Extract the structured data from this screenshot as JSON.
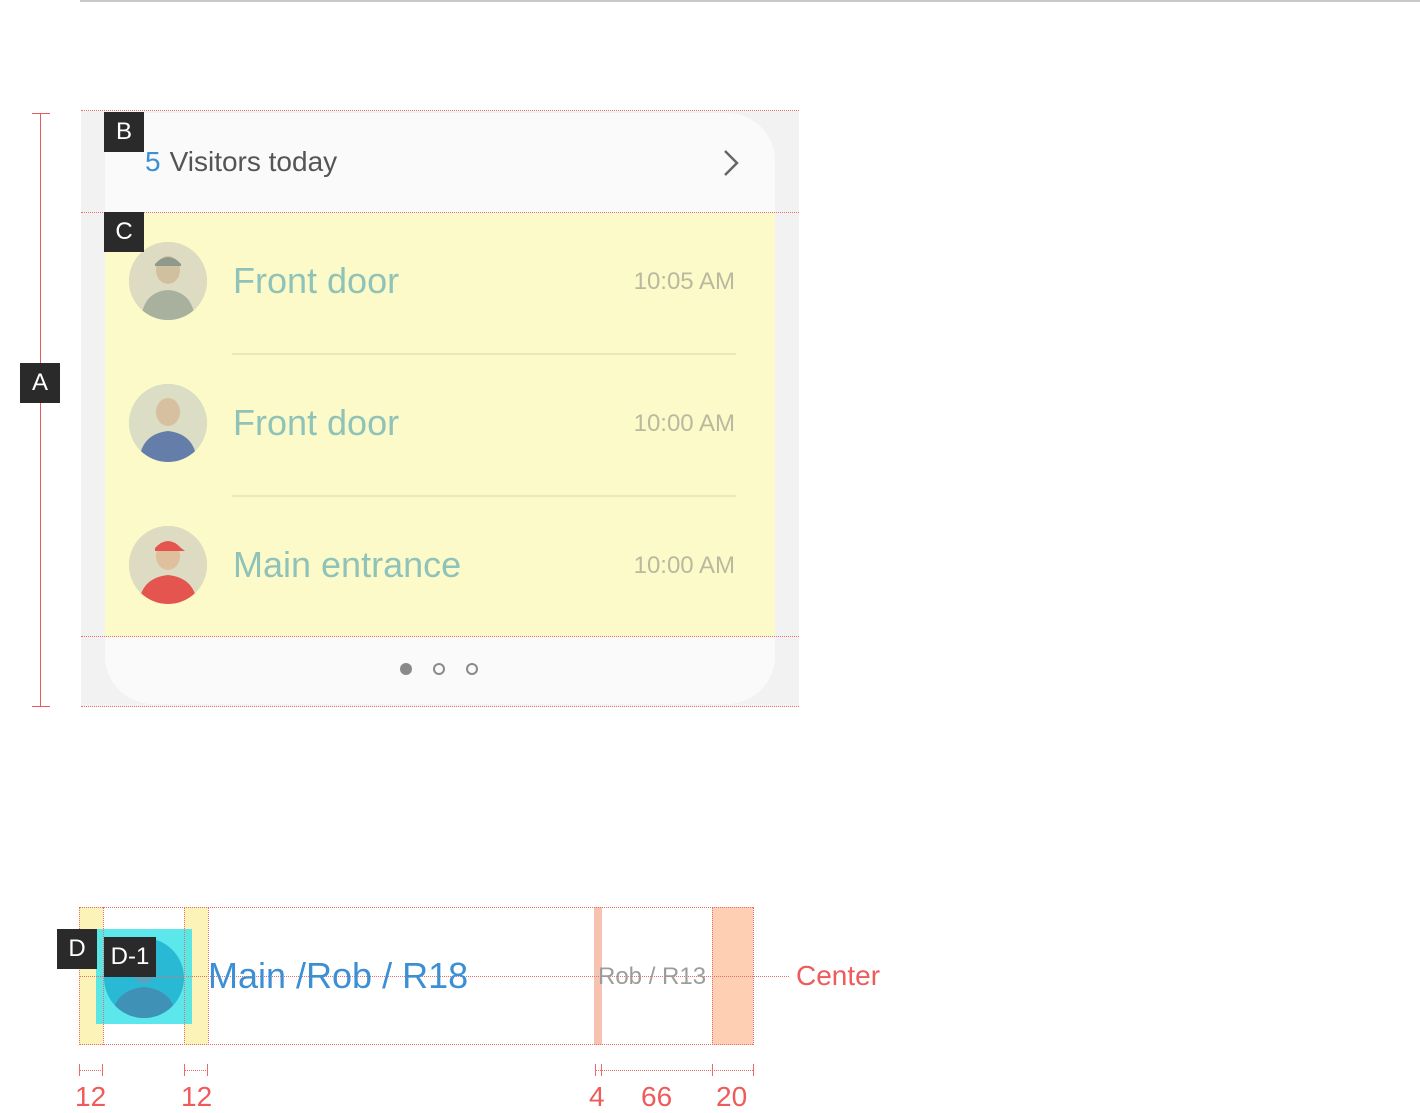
{
  "markers": {
    "a": "A",
    "b": "B",
    "c": "C",
    "d": "D",
    "d1": "D-1"
  },
  "widget": {
    "header": {
      "count": "5",
      "title": "Visitors today",
      "chevron_icon": "chevron-right-icon"
    },
    "visitors": [
      {
        "location": "Front door",
        "time": "10:05 AM",
        "avatar": "visitor-avatar-cap"
      },
      {
        "location": "Front door",
        "time": "10:00 AM",
        "avatar": "visitor-avatar-blue-shirt"
      },
      {
        "location": "Main entrance",
        "time": "10:00 AM",
        "avatar": "visitor-avatar-red-cap"
      }
    ],
    "pagination": {
      "pages": 3,
      "active": 1
    }
  },
  "spec_detail": {
    "title_font": "Main /Rob / R18",
    "time_font": "Rob / R13",
    "alignment": "Center",
    "dimensions": {
      "left_padding": "12",
      "avatar_gap": "12",
      "time_gap": "4",
      "time_width": "66",
      "right_padding": "20"
    }
  },
  "colors": {
    "accent": "#3d8fd4",
    "spec_red": "#ef5a5a",
    "list_highlight": "#fcfac8",
    "avatar_highlight": "#3fe3ea",
    "padding_highlight": "#fcf3b9",
    "margin_highlight": "#ffcfb3"
  }
}
